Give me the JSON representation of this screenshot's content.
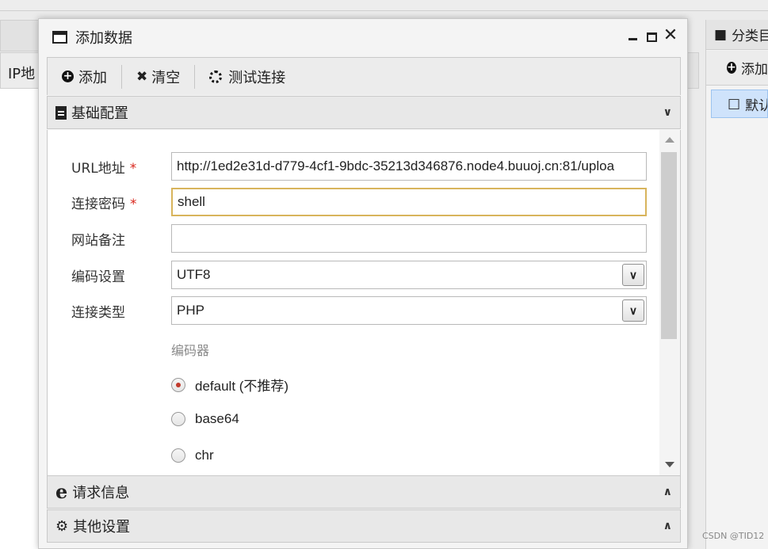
{
  "background": {
    "left_header_fragment": "IP地",
    "right_panel": {
      "header": "分类目",
      "add": "添加",
      "item": "默认"
    },
    "watermark": "CSDN @TID12"
  },
  "dialog": {
    "title": "添加数据",
    "toolbar": {
      "add": "添加",
      "clear": "清空",
      "test": "测试连接"
    },
    "panels": {
      "basic": "基础配置",
      "request": "请求信息",
      "other": "其他设置"
    },
    "form": {
      "url_label": "URL地址",
      "url_value": "http://1ed2e31d-d779-4cf1-9bdc-35213d346876.node4.buuoj.cn:81/uploa",
      "password_label": "连接密码",
      "password_value": "shell",
      "note_label": "网站备注",
      "note_value": "",
      "encoding_label": "编码设置",
      "encoding_value": "UTF8",
      "type_label": "连接类型",
      "type_value": "PHP",
      "required_mark": "*",
      "encoder_section": "编码器",
      "encoders": [
        {
          "label": "default (不推荐)",
          "checked": true
        },
        {
          "label": "base64",
          "checked": false
        },
        {
          "label": "chr",
          "checked": false
        }
      ]
    }
  },
  "colors": {
    "focus_border": "#d8b45c",
    "required": "#d9261c",
    "selected_item": "#cfe3fb"
  }
}
